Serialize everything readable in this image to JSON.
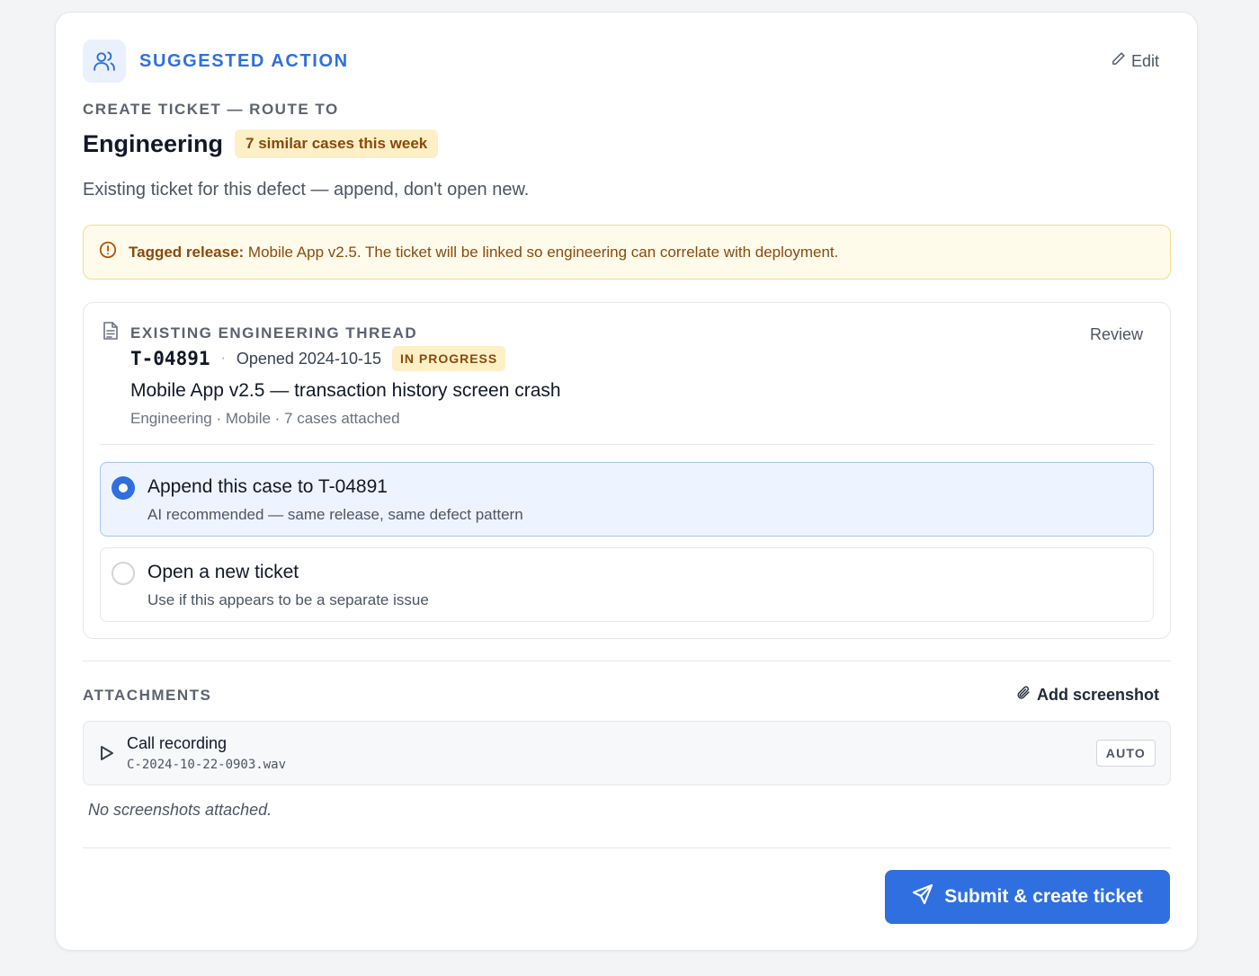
{
  "header": {
    "title": "SUGGESTED ACTION",
    "icon": "users-icon",
    "edit_label": "Edit"
  },
  "route": {
    "eyebrow": "CREATE TICKET — ROUTE TO",
    "name": "Engineering",
    "similar_badge": "7 similar cases this week",
    "description": "Existing ticket for this defect — append, don't open new."
  },
  "alert": {
    "label": "Tagged release:",
    "text": " Mobile App v2.5. The ticket will be linked so engineering can correlate with deployment."
  },
  "thread": {
    "label": "EXISTING ENGINEERING THREAD",
    "review_label": "Review",
    "ticket_id": "T-04891",
    "separator": "·",
    "opened": "Opened 2024-10-15",
    "status": "IN PROGRESS",
    "title": "Mobile App v2.5 — transaction history screen crash",
    "meta": "Engineering · Mobile · 7 cases attached",
    "options": [
      {
        "title": "Append this case to T-04891",
        "subtitle": "AI recommended — same release, same defect pattern",
        "selected": true
      },
      {
        "title": "Open a new ticket",
        "subtitle": "Use if this appears to be a separate issue",
        "selected": false
      }
    ]
  },
  "attachments": {
    "label": "ATTACHMENTS",
    "add_label": "Add screenshot",
    "items": [
      {
        "name": "Call recording",
        "file": "C-2024-10-22-0903.wav",
        "badge": "AUTO"
      }
    ],
    "empty_text": "No screenshots attached."
  },
  "submit_label": "Submit & create ticket",
  "colors": {
    "accent": "#2f6fe0",
    "warning_bg": "#fdf0c7",
    "warning_text": "#8a4a0c"
  }
}
